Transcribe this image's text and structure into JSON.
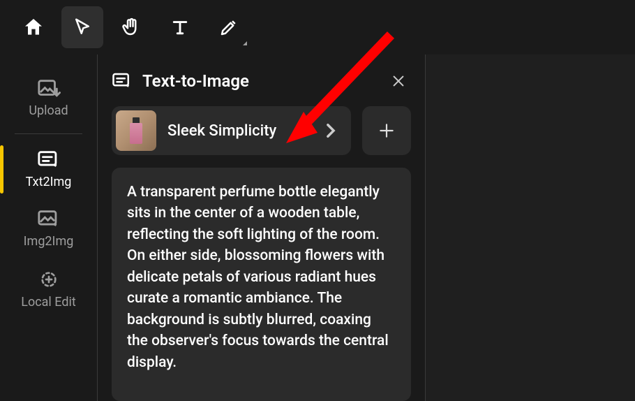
{
  "toolbar": {
    "home": "home",
    "pointer": "pointer",
    "pan": "pan",
    "text": "text",
    "highlighter": "highlighter"
  },
  "sidebar": {
    "items": [
      {
        "label": "Upload",
        "icon": "image-upload-icon"
      },
      {
        "label": "Txt2Img",
        "icon": "text-to-image-icon"
      },
      {
        "label": "Img2Img",
        "icon": "image-to-image-icon"
      },
      {
        "label": "Local Edit",
        "icon": "local-edit-icon"
      }
    ]
  },
  "panel": {
    "title": "Text-to-Image",
    "style_label": "Sleek Simplicity",
    "prompt": "A transparent perfume bottle elegantly sits in the center of a wooden table, reflecting the soft lighting of the room. On either side, blossoming flowers with delicate petals of various radiant hues curate a romantic ambiance. The background is subtly blurred, coaxing the observer's focus towards the central display."
  },
  "colors": {
    "accent": "#f7c600",
    "arrow": "#ff0000"
  }
}
